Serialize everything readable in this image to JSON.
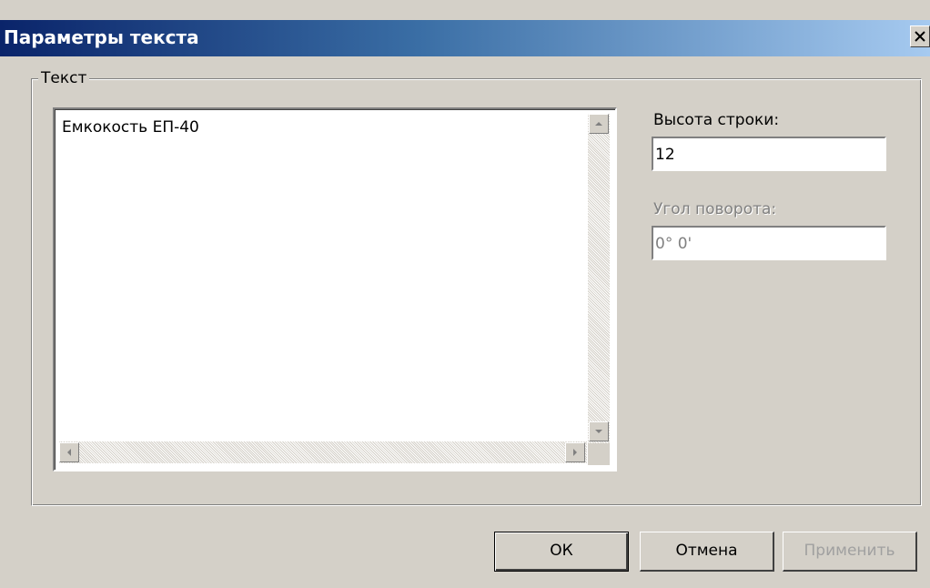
{
  "window": {
    "title": "Параметры текста"
  },
  "group": {
    "label": "Текст"
  },
  "memo": {
    "text": "Емкокость ЕП-40"
  },
  "line_height": {
    "label": "Высота строки:",
    "value": "12"
  },
  "rotation": {
    "label": "Угол поворота:",
    "value": "0° 0'"
  },
  "buttons": {
    "ok": "ОК",
    "cancel": "Отмена",
    "apply": "Применить"
  },
  "icons": {
    "close": "close-icon",
    "scroll_up": "arrow-up-icon",
    "scroll_down": "arrow-down-icon",
    "scroll_left": "arrow-left-icon",
    "scroll_right": "arrow-right-icon"
  },
  "colors": {
    "titlebar_start": "#0a246a",
    "titlebar_end": "#a6caf0",
    "dialog_bg": "#d4d0c8",
    "disabled_text": "#808080"
  }
}
